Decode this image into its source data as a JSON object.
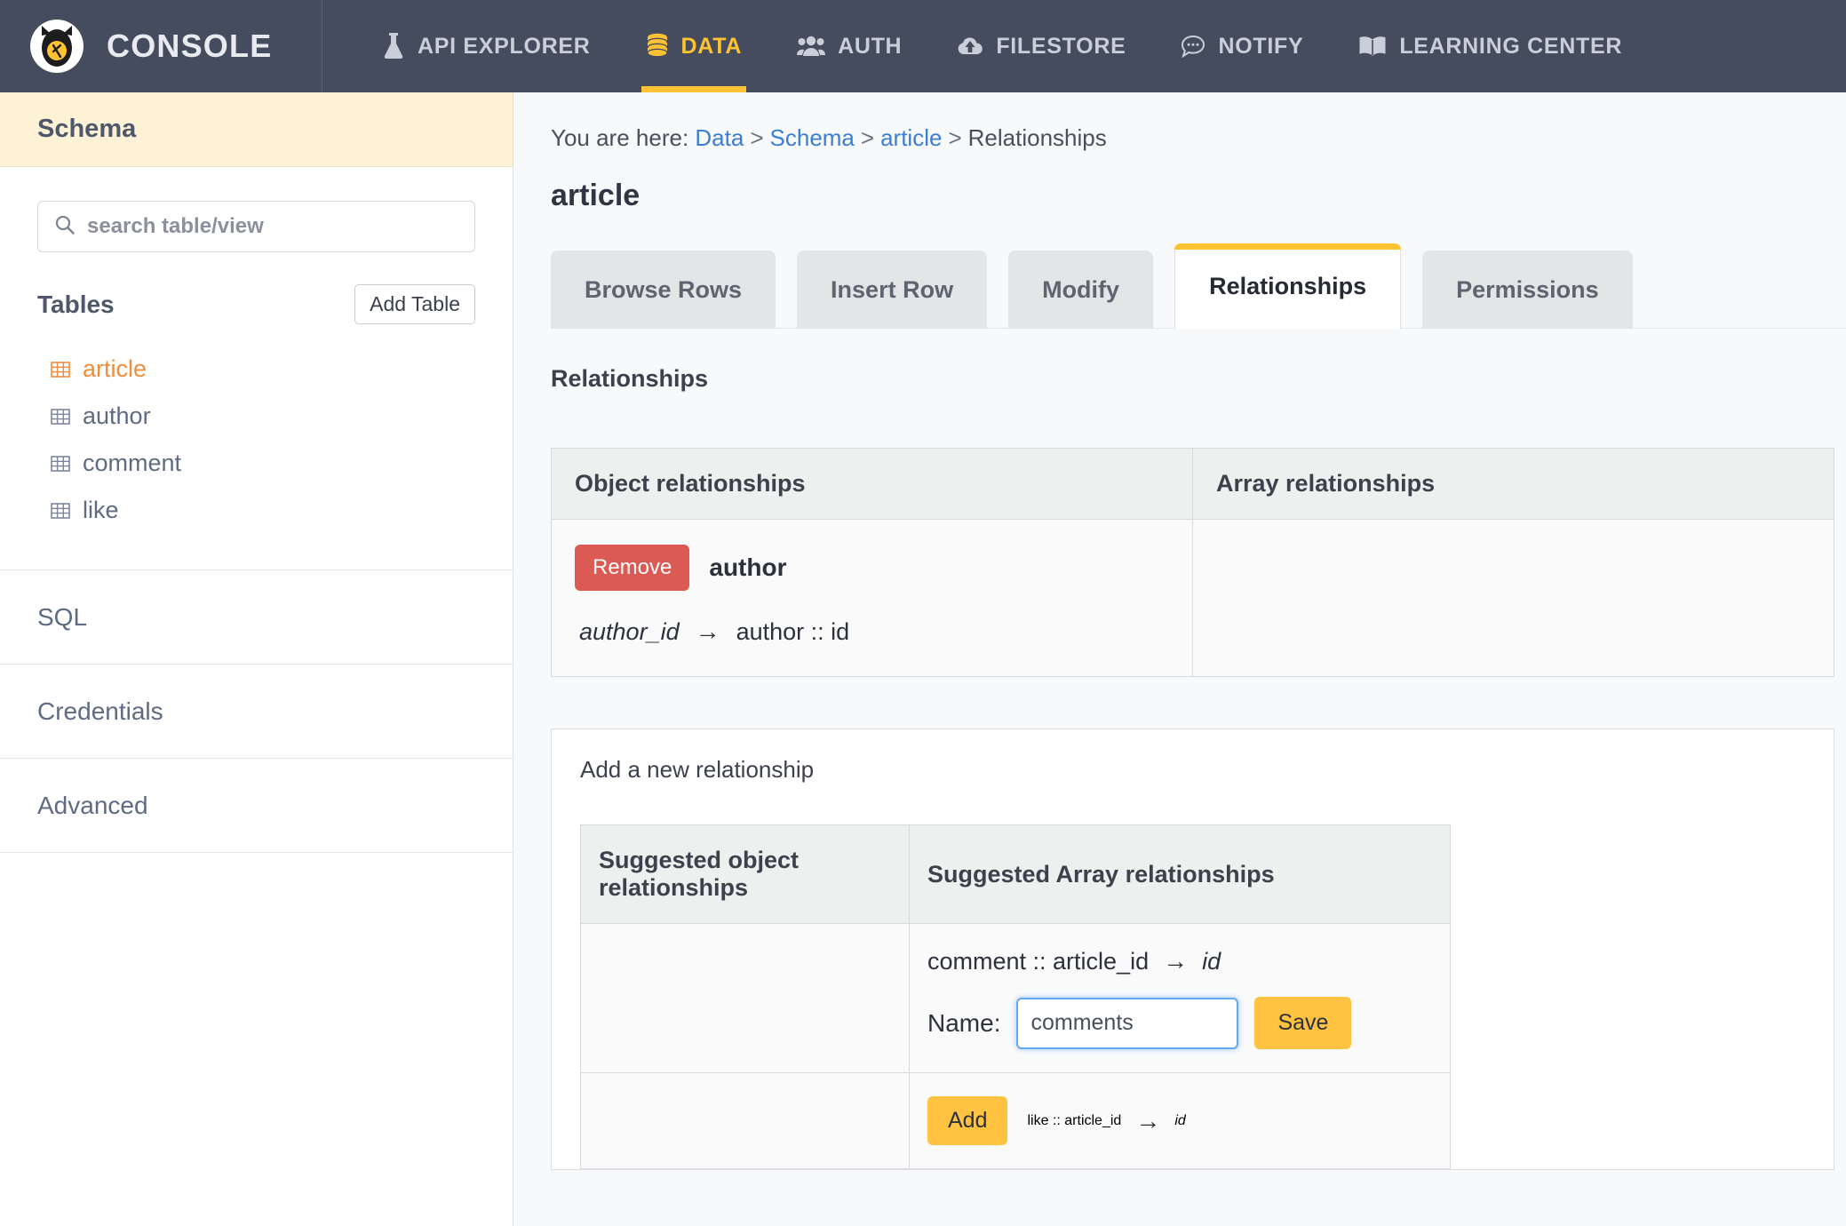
{
  "nav": {
    "brand": "CONSOLE",
    "items": [
      {
        "label": "API EXPLORER",
        "icon": "flask-icon",
        "active": false
      },
      {
        "label": "DATA",
        "icon": "database-icon",
        "active": true
      },
      {
        "label": "AUTH",
        "icon": "users-icon",
        "active": false
      },
      {
        "label": "FILESTORE",
        "icon": "cloud-upload-icon",
        "active": false
      },
      {
        "label": "NOTIFY",
        "icon": "chat-bubble-icon",
        "active": false
      },
      {
        "label": "LEARNING CENTER",
        "icon": "book-icon",
        "active": false
      }
    ]
  },
  "sidebar": {
    "header": "Schema",
    "search_placeholder": "search table/view",
    "tables_label": "Tables",
    "add_table_label": "Add Table",
    "tables": [
      {
        "name": "article",
        "selected": true
      },
      {
        "name": "author",
        "selected": false
      },
      {
        "name": "comment",
        "selected": false
      },
      {
        "name": "like",
        "selected": false
      }
    ],
    "links": [
      "SQL",
      "Credentials",
      "Advanced"
    ]
  },
  "breadcrumb": {
    "prefix": "You are here:",
    "items": [
      "Data",
      "Schema",
      "article",
      "Relationships"
    ],
    "separator": ">"
  },
  "page": {
    "title": "article",
    "tabs": [
      {
        "label": "Browse Rows",
        "active": false
      },
      {
        "label": "Insert Row",
        "active": false
      },
      {
        "label": "Modify",
        "active": false
      },
      {
        "label": "Relationships",
        "active": true
      },
      {
        "label": "Permissions",
        "active": false
      }
    ],
    "section_label": "Relationships"
  },
  "relationships": {
    "headers": [
      "Object relationships",
      "Array relationships"
    ],
    "object": [
      {
        "remove_label": "Remove",
        "name": "author",
        "from_column": "author_id",
        "arrow": "→",
        "to_target": "author :: id"
      }
    ],
    "array": []
  },
  "add_relationship": {
    "title": "Add a new relationship",
    "headers": [
      "Suggested object relationships",
      "Suggested Array relationships"
    ],
    "rows": [
      {
        "object": null,
        "array": {
          "source": "comment :: article_id",
          "arrow": "→",
          "target": "id",
          "editing": true,
          "name_label": "Name:",
          "name_value": "comments",
          "save_label": "Save"
        }
      },
      {
        "object": null,
        "array": {
          "add_label": "Add",
          "source": "like :: article_id",
          "arrow": "→",
          "target": "id",
          "editing": false
        }
      }
    ]
  },
  "colors": {
    "nav_bg": "#444c5e",
    "accent": "#ffc233",
    "danger": "#db5a53",
    "link": "#3b7fd4",
    "selected_table": "#f08c3a",
    "schema_header_bg": "#fdf1d6"
  }
}
